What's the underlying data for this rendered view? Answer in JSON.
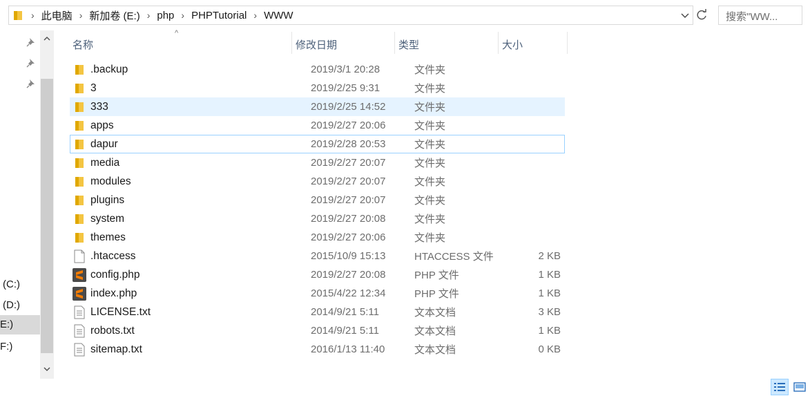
{
  "address": {
    "breadcrumbs": [
      "此电脑",
      "新加卷 (E:)",
      "php",
      "PHPTutorial",
      "WWW"
    ],
    "search_placeholder": "搜索\"WW..."
  },
  "nav": {
    "items": [
      {
        "label": "(C:)"
      },
      {
        "label": "(D:)"
      },
      {
        "label": "E:)"
      },
      {
        "label": "F:)"
      }
    ]
  },
  "columns": {
    "name": "名称",
    "date": "修改日期",
    "type": "类型",
    "size": "大小"
  },
  "files": [
    {
      "name": ".backup",
      "date": "2019/3/1 20:28",
      "type": "文件夹",
      "size": "",
      "icon": "folder-icon"
    },
    {
      "name": "3",
      "date": "2019/2/25 9:31",
      "type": "文件夹",
      "size": "",
      "icon": "folder-icon"
    },
    {
      "name": "333",
      "date": "2019/2/25 14:52",
      "type": "文件夹",
      "size": "",
      "icon": "folder-icon"
    },
    {
      "name": "apps",
      "date": "2019/2/27 20:06",
      "type": "文件夹",
      "size": "",
      "icon": "folder-icon"
    },
    {
      "name": "dapur",
      "date": "2019/2/28 20:53",
      "type": "文件夹",
      "size": "",
      "icon": "folder-icon"
    },
    {
      "name": "media",
      "date": "2019/2/27 20:07",
      "type": "文件夹",
      "size": "",
      "icon": "folder-icon"
    },
    {
      "name": "modules",
      "date": "2019/2/27 20:07",
      "type": "文件夹",
      "size": "",
      "icon": "folder-icon"
    },
    {
      "name": "plugins",
      "date": "2019/2/27 20:07",
      "type": "文件夹",
      "size": "",
      "icon": "folder-icon"
    },
    {
      "name": "system",
      "date": "2019/2/27 20:08",
      "type": "文件夹",
      "size": "",
      "icon": "folder-icon"
    },
    {
      "name": "themes",
      "date": "2019/2/27 20:06",
      "type": "文件夹",
      "size": "",
      "icon": "folder-icon"
    },
    {
      "name": ".htaccess",
      "date": "2015/10/9 15:13",
      "type": "HTACCESS 文件",
      "size": "2 KB",
      "icon": "blank-file-icon"
    },
    {
      "name": "config.php",
      "date": "2019/2/27 20:08",
      "type": "PHP 文件",
      "size": "1 KB",
      "icon": "sublime-php-icon"
    },
    {
      "name": "index.php",
      "date": "2015/4/22 12:34",
      "type": "PHP 文件",
      "size": "1 KB",
      "icon": "sublime-php-icon"
    },
    {
      "name": "LICENSE.txt",
      "date": "2014/9/21 5:11",
      "type": "文本文档",
      "size": "3 KB",
      "icon": "text-file-icon"
    },
    {
      "name": "robots.txt",
      "date": "2014/9/21 5:11",
      "type": "文本文档",
      "size": "1 KB",
      "icon": "text-file-icon"
    },
    {
      "name": "sitemap.txt",
      "date": "2016/1/13 11:40",
      "type": "文本文档",
      "size": "0 KB",
      "icon": "text-file-icon"
    }
  ],
  "state": {
    "hover_row": "333",
    "focused_row": "dapur",
    "selected_nav": "E:)"
  },
  "colors": {
    "folder": "#f4c542",
    "hover": "#e5f3ff",
    "focus_border": "#99d1ff",
    "header_text": "#4c607a",
    "sublime": "#f57c00"
  }
}
